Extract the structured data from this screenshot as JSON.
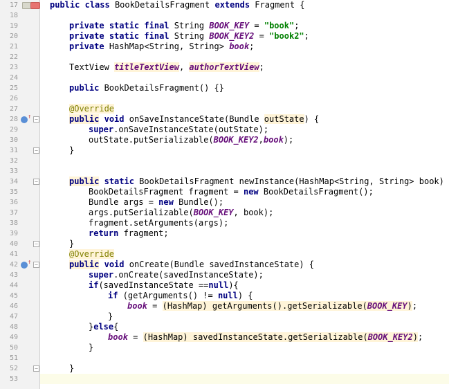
{
  "lines": {
    "start": 17,
    "end": 53
  },
  "tokens": {
    "l17_public": "public",
    "l17_class": "class",
    "l17_name": "BookDetailsFragment",
    "l17_extends": "extends",
    "l17_super": "Fragment {",
    "l19_private": "private",
    "l19_static": "static",
    "l19_final": "final",
    "l19_type": "String",
    "l19_field": "BOOK_KEY",
    "l19_eq": " = ",
    "l19_val": "\"book\"",
    "l19_semi": ";",
    "l20_private": "private",
    "l20_static": "static",
    "l20_final": "final",
    "l20_type": "String",
    "l20_field": "BOOK_KEY2",
    "l20_eq": " = ",
    "l20_val": "\"book2\"",
    "l20_semi": ";",
    "l21_private": "private",
    "l21_type": "HashMap<String, String> ",
    "l21_field": "book",
    "l21_semi": ";",
    "l23_type": "TextView ",
    "l23_f1": "titleTextView",
    "l23_comma": ", ",
    "l23_f2": "authorTextView",
    "l23_semi": ";",
    "l25_public": "public",
    "l25_ctor": " BookDetailsFragment() {}",
    "l27_anno": "@Override",
    "l28_public": "public",
    "l28_void": "void",
    "l28_name": " onSaveInstanceState(Bundle ",
    "l28_param": "outState",
    "l28_close": ") {",
    "l29_super": "super",
    "l29_call": ".onSaveInstanceState(outState);",
    "l30_obj": "outState.putSerializable(",
    "l30_arg1": "BOOK_KEY2",
    "l30_comma": ",",
    "l30_arg2": "book",
    "l30_close": ");",
    "l31_brace": "}",
    "l34_public": "public",
    "l34_static": "static",
    "l34_sig": " BookDetailsFragment newInstance(HashMap<String, String> book) {",
    "l35_body": "BookDetailsFragment fragment = ",
    "l35_new": "new",
    "l35_rest": " BookDetailsFragment();",
    "l36_body": "Bundle args = ",
    "l36_new": "new",
    "l36_rest": " Bundle();",
    "l37_body": "args.putSerializable(",
    "l37_arg": "BOOK_KEY",
    "l37_rest": ", book);",
    "l38_body": "fragment.setArguments(args);",
    "l39_return": "return",
    "l39_rest": " fragment;",
    "l40_brace": "}",
    "l41_anno": "@Override",
    "l42_public": "public",
    "l42_void": "void",
    "l42_sig": " onCreate(Bundle savedInstanceState) {",
    "l43_super": "super",
    "l43_rest": ".onCreate(savedInstanceState);",
    "l44_if": "if",
    "l44_cond": "(savedInstanceState ==",
    "l44_null": "null",
    "l44_close": "){",
    "l45_if": "if",
    "l45_cond": " (getArguments() != ",
    "l45_null": "null",
    "l45_close": ") {",
    "l46_field": "book",
    "l46_eq": " = ",
    "l46_cast": "(HashMap) getArguments().getSerializable(",
    "l46_key": "BOOK_KEY",
    "l46_close": ")",
    "l46_semi": ";",
    "l47_brace": "}",
    "l48_else_open": "}",
    "l48_else": "else",
    "l48_else_close": "{",
    "l49_field": "book",
    "l49_eq": " =  ",
    "l49_cast": "(HashMap) savedInstanceState.getSerializable(",
    "l49_key": "BOOK_KEY2",
    "l49_close": ")",
    "l49_semi": ";",
    "l50_brace": "}",
    "l52_brace": "}"
  }
}
